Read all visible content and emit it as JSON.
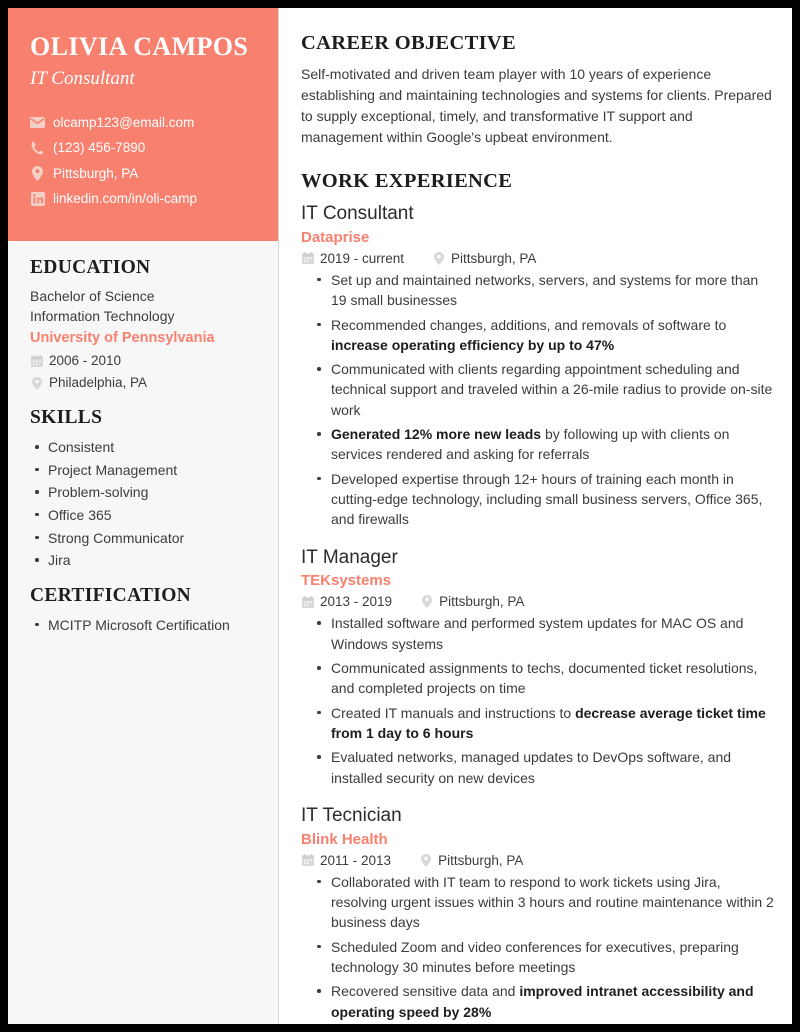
{
  "theme": {
    "accent": "#f8806f",
    "sidebar_bg": "#f7f7f7",
    "text": "#3c3c40",
    "heading": "#1d1d20",
    "page_bg": "#ffffff",
    "frame": "#000000"
  },
  "sidebar": {
    "name": "OLIVIA CAMPOS",
    "job_title": "IT Consultant",
    "contacts": [
      {
        "icon": "envelope-icon",
        "value": "olcamp123@email.com"
      },
      {
        "icon": "phone-icon",
        "value": "(123) 456-7890"
      },
      {
        "icon": "location-pin-icon",
        "value": "Pittsburgh, PA"
      },
      {
        "icon": "linkedin-icon",
        "value": "linkedin.com/in/oli-camp"
      }
    ],
    "education": {
      "heading": "EDUCATION",
      "degree": "Bachelor of Science",
      "field": "Information Technology",
      "school": "University of Pennsylvania",
      "dates": "2006 - 2010",
      "location": "Philadelphia, PA"
    },
    "skills": {
      "heading": "SKILLS",
      "items": [
        "Consistent",
        "Project Management",
        "Problem-solving",
        "Office 365",
        "Strong Communicator",
        "Jira"
      ]
    },
    "certification": {
      "heading": "CERTIFICATION",
      "items": [
        "MCITP Microsoft Certification"
      ]
    }
  },
  "main": {
    "objective": {
      "heading": "CAREER OBJECTIVE",
      "text": "Self-motivated and driven team player with 10 years of experience establishing and maintaining technologies and systems for clients. Prepared to supply exceptional, timely, and transformative IT support and management within Google's upbeat environment."
    },
    "work": {
      "heading": "WORK EXPERIENCE",
      "jobs": [
        {
          "role": "IT Consultant",
          "company": "Dataprise",
          "dates": "2019 - current",
          "location": "Pittsburgh, PA",
          "bullets": [
            {
              "pre": "Set up and maintained networks, servers, and systems for more than 19 small businesses",
              "bold": "",
              "post": ""
            },
            {
              "pre": "Recommended changes, additions, and removals of software to ",
              "bold": "increase operating efficiency by up to 47%",
              "post": ""
            },
            {
              "pre": "Communicated with clients regarding appointment scheduling and technical support and traveled within a 26-mile radius to provide on-site work",
              "bold": "",
              "post": ""
            },
            {
              "pre": "",
              "bold": "Generated 12% more new leads",
              "post": " by following up with clients on services rendered and asking for referrals"
            },
            {
              "pre": "Developed expertise through 12+ hours of training each month in cutting-edge technology, including small business servers, Office 365, and firewalls",
              "bold": "",
              "post": ""
            }
          ]
        },
        {
          "role": "IT Manager",
          "company": "TEKsystems",
          "dates": "2013 - 2019",
          "location": "Pittsburgh, PA",
          "bullets": [
            {
              "pre": "Installed software and performed system updates for MAC OS and Windows systems",
              "bold": "",
              "post": ""
            },
            {
              "pre": "Communicated assignments to techs, documented ticket resolutions, and completed projects on time",
              "bold": "",
              "post": ""
            },
            {
              "pre": "Created IT manuals and instructions to ",
              "bold": "decrease average ticket time from 1 day to 6 hours",
              "post": ""
            },
            {
              "pre": "Evaluated networks, managed updates to DevOps software, and installed security on new devices",
              "bold": "",
              "post": ""
            }
          ]
        },
        {
          "role": "IT Tecnician",
          "company": "Blink Health",
          "dates": "2011 - 2013",
          "location": "Pittsburgh, PA",
          "bullets": [
            {
              "pre": "Collaborated with IT team to respond to work tickets using Jira, resolving urgent issues within 3 hours and routine maintenance within 2 business days",
              "bold": "",
              "post": ""
            },
            {
              "pre": "Scheduled Zoom and video conferences for executives, preparing technology 30 minutes before meetings",
              "bold": "",
              "post": ""
            },
            {
              "pre": "Recovered sensitive data and ",
              "bold": "improved intranet accessibility and operating speed by 28%",
              "post": ""
            }
          ]
        }
      ]
    }
  }
}
